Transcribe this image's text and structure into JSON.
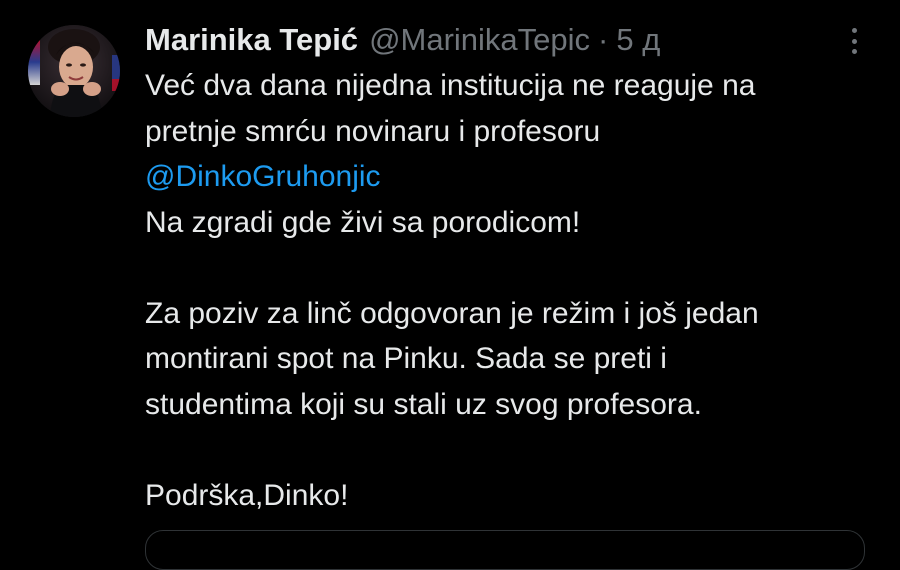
{
  "tweet": {
    "display_name": "Marinika Tepić",
    "handle": "@MarinikaTepic",
    "separator": "·",
    "time": "5 д",
    "avatar_icon": "profile-photo",
    "more_icon": "more-vertical-icon",
    "text": {
      "line1": "Već dva dana nijedna institucija ne reaguje na",
      "line2": "pretnje smrću novinaru i profesoru",
      "mention": "@DinkoGruhonjic",
      "line4": "Na zgradi gde živi sa porodicom!",
      "line5": "Za poziv za linč odgovoran je režim i još jedan",
      "line6": "montirani spot na Pinku. Sada se preti i",
      "line7": "studentima koji su stali uz svog profesora.",
      "line8": "Podrška,Dinko!"
    }
  },
  "colors": {
    "background": "#000000",
    "primary_text": "#e7e9ea",
    "secondary_text": "#71767b",
    "link": "#1d9bf0"
  }
}
